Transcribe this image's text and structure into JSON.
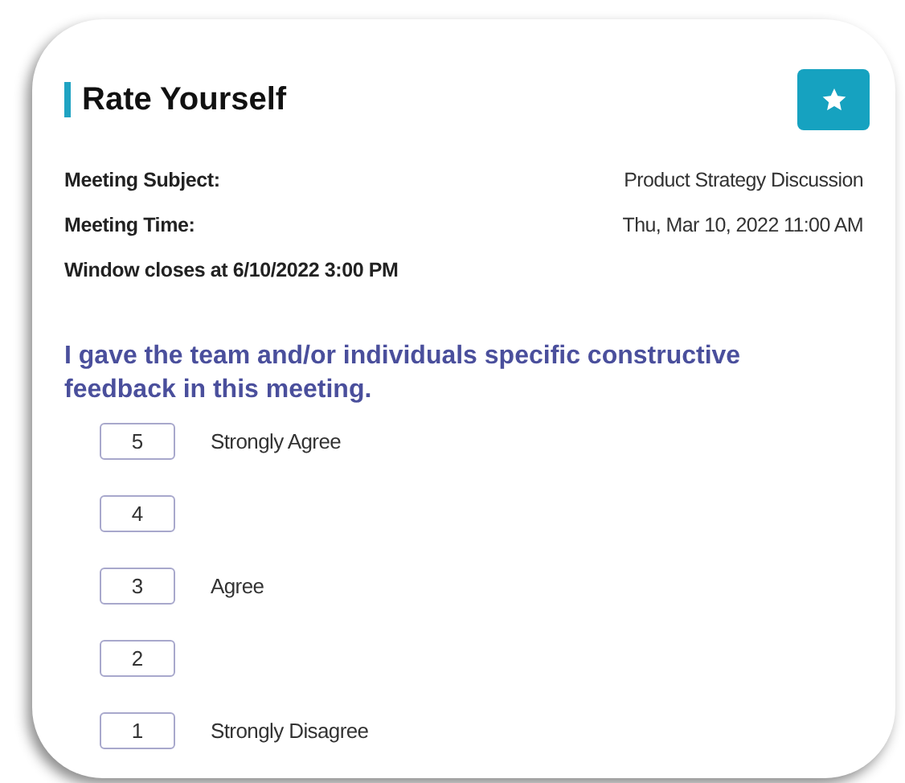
{
  "title": "Rate Yourself",
  "details": [
    {
      "label": "Meeting Subject:",
      "value": "Product Strategy Discussion"
    },
    {
      "label": "Meeting Time:",
      "value": "Thu, Mar 10, 2022 11:00 AM"
    }
  ],
  "window_notice": "Window closes at 6/10/2022 3:00 PM",
  "question": "I gave the team and/or individuals specific constructive feedback in this meeting.",
  "options": [
    {
      "score": "5",
      "label": "Strongly Agree"
    },
    {
      "score": "4"
    },
    {
      "score": "3",
      "label": "Agree"
    },
    {
      "score": "2"
    },
    {
      "score": "1",
      "label": "Strongly Disagree"
    }
  ]
}
